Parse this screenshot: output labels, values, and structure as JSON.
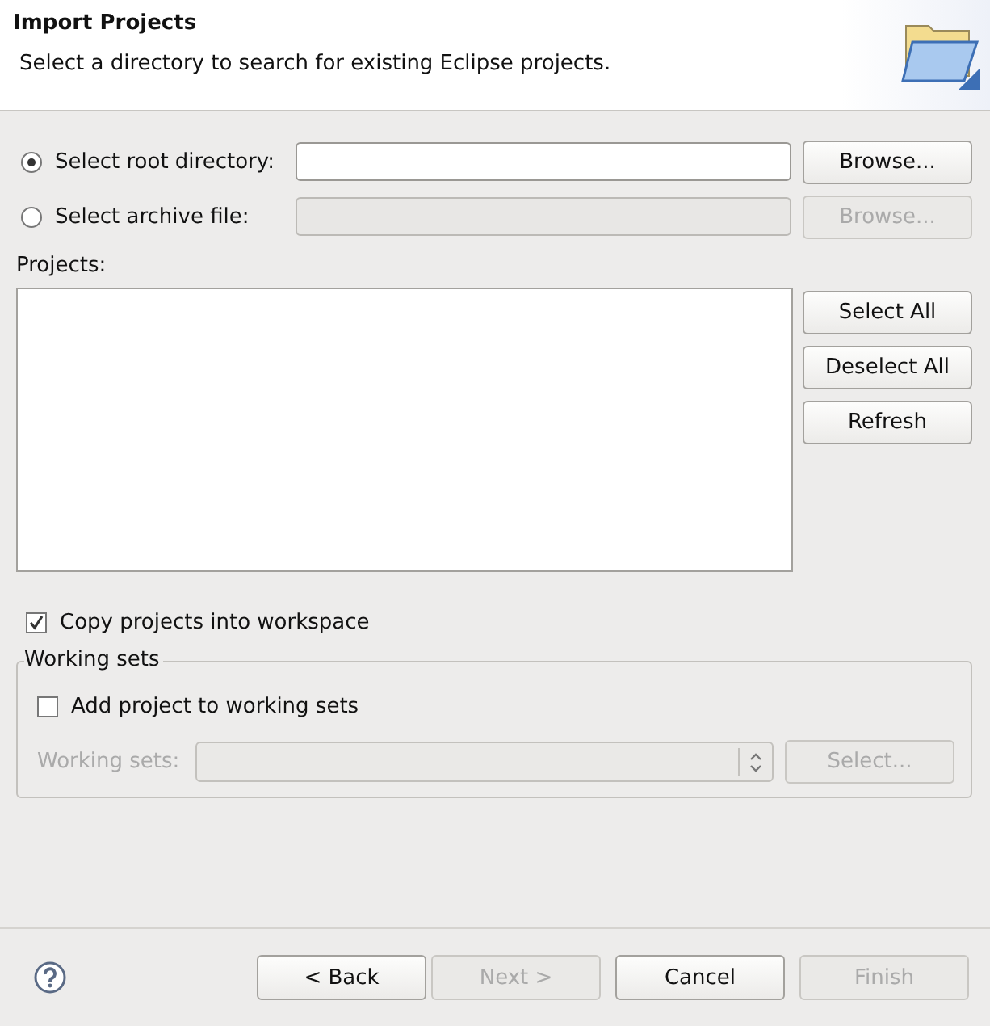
{
  "header": {
    "title": "Import Projects",
    "description": "Select a directory to search for existing Eclipse projects."
  },
  "sources": [
    {
      "label": "Select root directory:",
      "selected": true,
      "disabled": false,
      "browse": "Browse...",
      "browse_disabled": false
    },
    {
      "label": "Select archive file:",
      "selected": false,
      "disabled": true,
      "browse": "Browse...",
      "browse_disabled": true
    }
  ],
  "projects": {
    "label": "Projects:",
    "buttons": [
      "Select All",
      "Deselect All",
      "Refresh"
    ]
  },
  "copy_option": {
    "label": "Copy projects into workspace",
    "checked": true
  },
  "working_sets": {
    "legend": "Working sets",
    "add_option": {
      "label": "Add project to working sets",
      "checked": false
    },
    "combo_label": "Working sets:",
    "combo_disabled": true,
    "select_button": "Select...",
    "select_disabled": true
  },
  "footer_buttons": [
    {
      "label": "< Back",
      "disabled": false
    },
    {
      "label": "Next >",
      "disabled": true
    },
    {
      "label": "Cancel",
      "disabled": false
    },
    {
      "label": "Finish",
      "disabled": true
    }
  ]
}
